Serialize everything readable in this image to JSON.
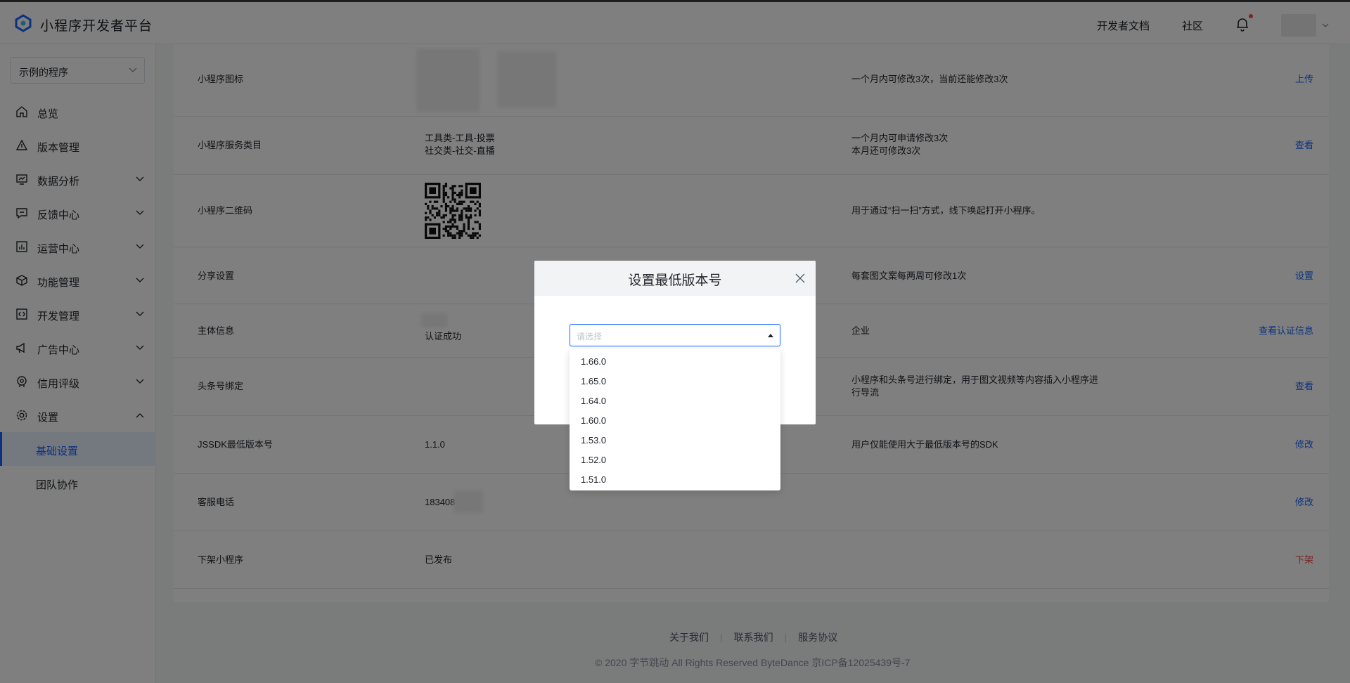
{
  "topbar": {
    "brand": "小程序开发者平台",
    "docs_link": "开发者文档",
    "community_link": "社区"
  },
  "sidebar": {
    "app_select": "示例的程序",
    "items": [
      {
        "label": "总览",
        "icon": "home-icon"
      },
      {
        "label": "版本管理",
        "icon": "version-icon"
      },
      {
        "label": "数据分析",
        "icon": "monitor-chart-icon",
        "expandable": true
      },
      {
        "label": "反馈中心",
        "icon": "feedback-icon",
        "expandable": true
      },
      {
        "label": "运营中心",
        "icon": "bar-chart-icon",
        "expandable": true
      },
      {
        "label": "功能管理",
        "icon": "cube-icon",
        "expandable": true
      },
      {
        "label": "开发管理",
        "icon": "code-icon",
        "expandable": true
      },
      {
        "label": "广告中心",
        "icon": "megaphone-icon",
        "expandable": true
      },
      {
        "label": "信用评级",
        "icon": "badge-icon",
        "expandable": true
      },
      {
        "label": "设置",
        "icon": "gear-icon",
        "expanded": true
      }
    ],
    "sub_items": [
      {
        "label": "基础设置",
        "active": true
      },
      {
        "label": "团队协作",
        "active": false
      }
    ]
  },
  "settings": {
    "rows": [
      {
        "label": "小程序图标",
        "note": "一个月内可修改3次，当前还能修改3次",
        "action": "上传"
      },
      {
        "label": "小程序服务类目",
        "value_line1": "工具类-工具-投票",
        "value_line2": "社交类-社交-直播",
        "note_line1": "一个月内可申请修改3次",
        "note_line2": "本月还可修改3次",
        "action": "查看"
      },
      {
        "label": "小程序二维码",
        "note": "用于通过“扫一扫”方式，线下唤起打开小程序。"
      },
      {
        "label": "分享设置",
        "note": "每套图文案每两周可修改1次",
        "action": "设置"
      },
      {
        "label": "主体信息",
        "value": "认证成功",
        "note": "企业",
        "action": "查看认证信息"
      },
      {
        "label": "头条号绑定",
        "note_line1": "小程序和头条号进行绑定，用于图文视频等内容插入小程序进",
        "note_line2": "行导流",
        "action": "查看"
      },
      {
        "label": "JSSDK最低版本号",
        "value": "1.1.0",
        "note": "用户仅能使用大于最低版本号的SDK",
        "action": "修改"
      },
      {
        "label": "客服电话",
        "value": "183408",
        "action": "修改"
      },
      {
        "label": "下架小程序",
        "value": "已发布",
        "action": "下架"
      }
    ]
  },
  "footer": {
    "about": "关于我们",
    "contact": "联系我们",
    "terms": "服务协议",
    "copyright": "© 2020 字节跳动 All Rights Reserved ByteDance 京ICP备12025439号-7"
  },
  "modal": {
    "title": "设置最低版本号",
    "select_placeholder": "请选择",
    "options": [
      "1.66.0",
      "1.65.0",
      "1.64.0",
      "1.60.0",
      "1.53.0",
      "1.52.0",
      "1.51.0"
    ]
  },
  "colors": {
    "accent": "#1664ff",
    "danger": "#f54a45",
    "overlay": "rgba(0,0,0,0.5)"
  }
}
